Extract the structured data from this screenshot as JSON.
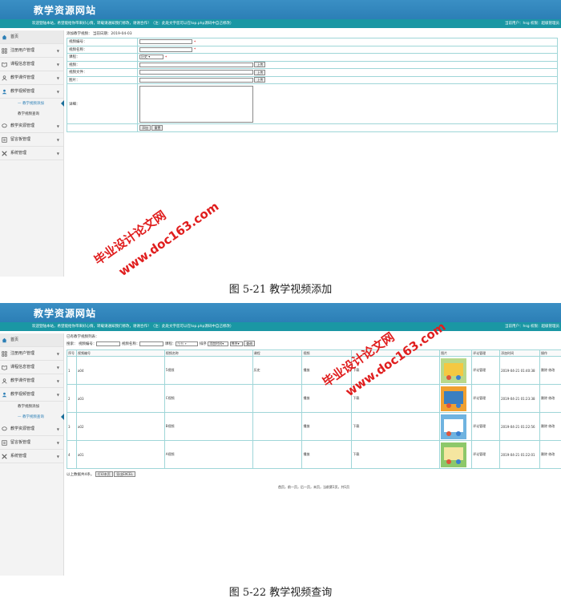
{
  "site_title": "教学资源网站",
  "welcome_text": "欢迎登陆本站，希望能给你带来好心情，转载请通知我们修改，谢谢合作！（注：此处文字您可以在top.php源码中自己修改）",
  "user_area": "当前用户：hsg  权限：超级管理员",
  "menu": [
    {
      "label": "首页"
    },
    {
      "label": "注册用户管理"
    },
    {
      "label": "课程信息管理"
    },
    {
      "label": "教学课件管理"
    },
    {
      "label": "教学视频管理"
    },
    {
      "label": "教学资源管理"
    },
    {
      "label": "留言板管理"
    },
    {
      "label": "系统管理"
    }
  ],
  "submenu": [
    "教学视频添加",
    "教学视频查询"
  ],
  "add_form": {
    "breadcrumb": "添加教学视频：   当前日期：2019-04-03",
    "fields": [
      "视频编号：",
      "视频名称：",
      "课程：",
      "视频：",
      "视频文件：",
      "图片：",
      "详细："
    ],
    "course_value": "历史",
    "upload_label": "上传",
    "submit_label": "添加",
    "reset_label": "重置"
  },
  "list_page": {
    "breadcrumb": "已有教学视频列表：",
    "search_label": "搜索：",
    "f_code": "视频编号：",
    "f_name": "视频名称：",
    "f_course": "课程：",
    "course_placeholder": "所有",
    "sort_label": "排序",
    "sort_value": "添加时间",
    "order_value": "降序",
    "search_btn": "查询",
    "headers": [
      "序号",
      "视频编号",
      "视频名称",
      "课程",
      "视频",
      "",
      "图片",
      "评论管理",
      "添加时间",
      "操作"
    ],
    "rows": [
      {
        "no": "1",
        "code": "a04",
        "name": "5视频",
        "course": "历史",
        "video": "播放",
        "file": "下载",
        "comment": "评论管理",
        "time": "2019-04-21 01:40:38",
        "ops": "删除  修改"
      },
      {
        "no": "2",
        "code": "a03",
        "name": "C视频",
        "course": "",
        "video": "播放",
        "file": "下载",
        "comment": "评论管理",
        "time": "2019-04-21 01:23:38",
        "ops": "删除  修改"
      },
      {
        "no": "3",
        "code": "a02",
        "name": "B视频",
        "course": "",
        "video": "播放",
        "file": "下载",
        "comment": "评论管理",
        "time": "2019-04-21 01:22:56",
        "ops": "删除  修改"
      },
      {
        "no": "4",
        "code": "a01",
        "name": "A视频",
        "course": "",
        "video": "播放",
        "file": "下载",
        "comment": "评论管理",
        "time": "2019-04-21 01:22:01",
        "ops": "删除  修改"
      }
    ],
    "total_text": "以上数据共4条。",
    "print_btn": "打印本页",
    "excel_btn": "导出EXCEL",
    "pager": "首页，前一页，后一页，末页，当前第1页，共1页"
  },
  "caption1": "图 5-21 教学视频添加",
  "caption2": "图 5-22 教学视频查询",
  "watermark_cn": "毕业设计论文网",
  "watermark_url": "www.doc163.com",
  "colors": {
    "banner": "#2c7fb6",
    "bar": "#1a97a4",
    "watermark": "#e01e1e"
  }
}
